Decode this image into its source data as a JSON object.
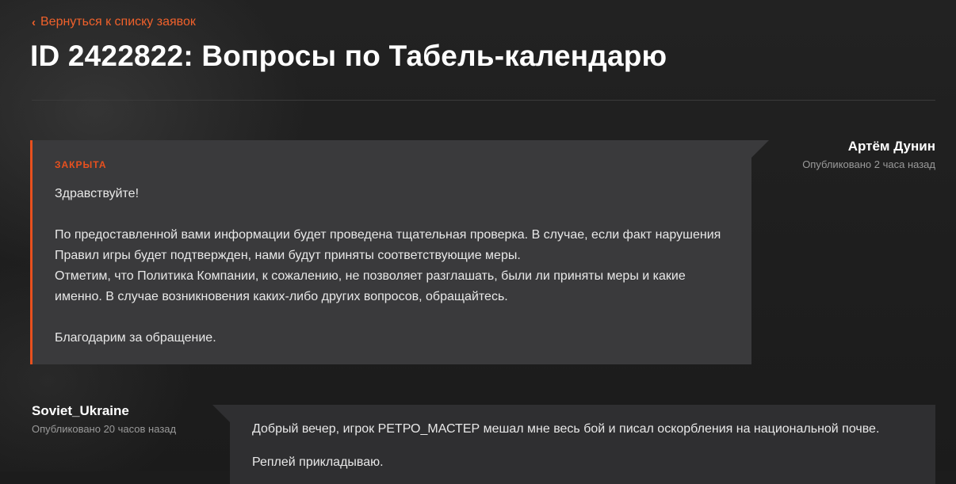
{
  "nav": {
    "back_label": "Вернуться к списку заявок"
  },
  "ticket": {
    "title": "ID 2422822: Вопросы по Табель-календарю"
  },
  "messages": [
    {
      "author": "Артём Дунин",
      "published": "Опубликовано 2 часа назад",
      "status": "ЗАКРЫТА",
      "lines": [
        "Здравствуйте!",
        "По предоставленной вами информации будет проведена тщательная проверка. В случае, если факт нарушения",
        "Правил игры будет подтвержден, нами будут приняты соответствующие меры.",
        "Отметим, что Политика Компании, к сожалению, не позволяет разглашать, были ли приняты меры и какие",
        "именно. В случае возникновения каких-либо других вопросов, обращайтесь.",
        "Благодарим за обращение."
      ]
    },
    {
      "author": "Soviet_Ukraine",
      "published": "Опубликовано 20 часов назад",
      "lines": [
        "Добрый вечер, игрок РЕТРО_МАСТЕР мешал мне весь бой и писал оскорбления на национальной почве.",
        "Реплей прикладываю."
      ]
    }
  ],
  "colors": {
    "accent": "#e8501e",
    "link": "#f0612b",
    "background": "#1c1c1c",
    "admin_bubble": "#3a3a3c",
    "user_bubble": "#2f2f31"
  }
}
